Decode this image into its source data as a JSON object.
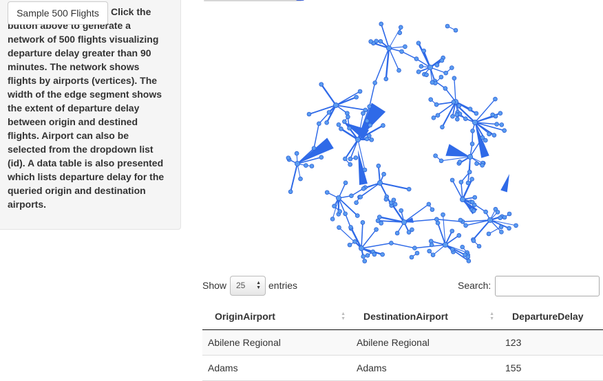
{
  "sidebar": {
    "button_label": "Sample 500 Flights",
    "description": "Click the button above to generate a network of 500 flights visualizing departure delay greater than 90 minutes. The network shows flights by airports (vertices). The width of the edge segment shows the extent of departure delay between origin and destined flights. Airport can also be selected from the dropdown list (id). A data table is also presented which lists departure delay for the queried origin and destination airports."
  },
  "table_controls": {
    "show_label": "Show",
    "page_length": "25",
    "entries_label": "entries",
    "search_label": "Search:",
    "search_value": ""
  },
  "table": {
    "columns": [
      "OriginAirport",
      "DestinationAirport",
      "DepartureDelay"
    ],
    "rows": [
      [
        "Abilene Regional",
        "Abilene Regional",
        "123"
      ],
      [
        "Adams",
        "Adams",
        "155"
      ]
    ]
  },
  "colors": {
    "node": "#5a9cf0",
    "edge": "#2f6ae8",
    "node_stroke": "#2b5fd6"
  }
}
